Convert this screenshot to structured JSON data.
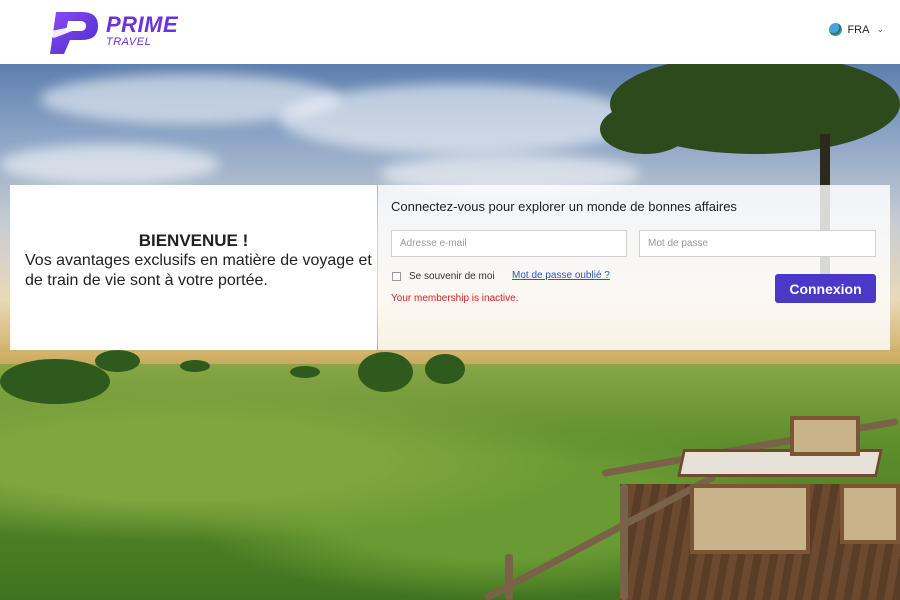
{
  "brand": {
    "name": "PRIME",
    "sub": "TRAVEL",
    "accent": "#6a35d8"
  },
  "header": {
    "language": "FRA",
    "language_icon": "globe-icon",
    "dropdown_icon": "chevron-down-icon"
  },
  "welcome": {
    "title": "BIENVENUE !",
    "text": "Vos avantages exclusifs en matière de voyage et de train de vie sont à votre portée."
  },
  "login": {
    "title": "Connectez-vous pour explorer un monde de bonnes affaires",
    "email": {
      "value": "",
      "placeholder": "Adresse e-mail"
    },
    "password": {
      "value": "",
      "placeholder": "Mot de passe"
    },
    "remember_label": "Se souvenir de moi",
    "remember_checked": false,
    "forgot_label": "Mot de passe oublié ?",
    "error_message": "Your membership is inactive.",
    "submit_label": "Connexion",
    "button_color": "#4b38c9",
    "error_color": "#d62020"
  }
}
